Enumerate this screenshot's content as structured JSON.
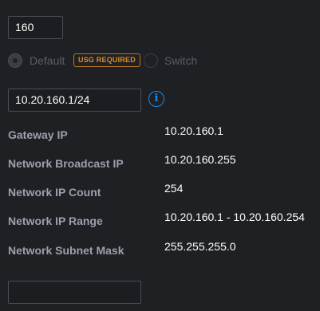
{
  "vlan": {
    "value": "160"
  },
  "router_type": {
    "default_label": "Default",
    "usg_badge": "USG REQUIRED",
    "switch_label": "Switch",
    "badge_color": "#e08a22"
  },
  "subnet": {
    "value": "10.20.160.1/24",
    "info_icon": "info-icon"
  },
  "details": [
    {
      "label": "Gateway IP",
      "value": "10.20.160.1"
    },
    {
      "label": "Network Broadcast IP",
      "value": "10.20.160.255"
    },
    {
      "label": "Network IP Count",
      "value": "254"
    },
    {
      "label": "Network IP Range",
      "value": "10.20.160.1 - 10.20.160.254"
    },
    {
      "label": "Network Subnet Mask",
      "value": "255.255.255.0"
    }
  ],
  "bottom_field": {
    "value": ""
  },
  "colors": {
    "background": "#1f2024",
    "accent": "#1e88e5"
  }
}
